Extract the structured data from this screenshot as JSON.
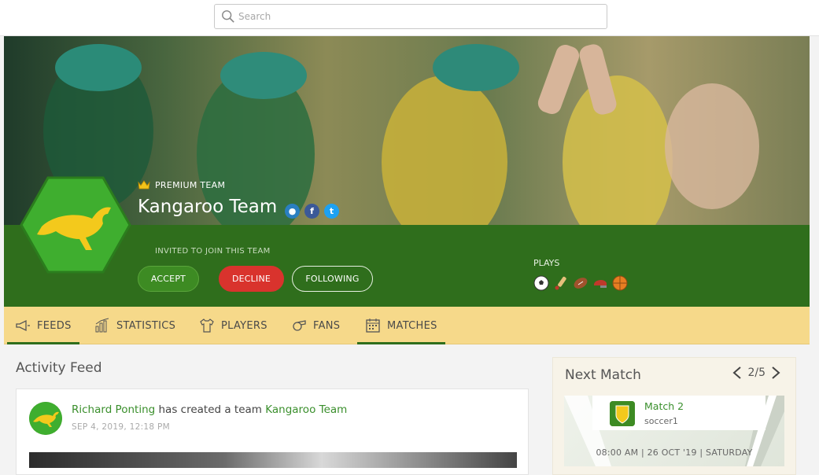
{
  "search": {
    "placeholder": "Search"
  },
  "team": {
    "premium_label": "PREMIUM TEAM",
    "name": "Kangaroo Team",
    "invited_label": "INVITED TO JOIN THIS TEAM",
    "plays_label": "PLAYS",
    "sports": [
      "soccer-ball-icon",
      "cricket-bat-icon",
      "rugby-ball-icon",
      "cricket-helmet-icon",
      "basketball-icon"
    ]
  },
  "actions": {
    "accept": "ACCEPT",
    "decline": "DECLINE",
    "following": "FOLLOWING"
  },
  "tabs": [
    {
      "label": "FEEDS",
      "icon": "megaphone-icon",
      "active": true
    },
    {
      "label": "STATISTICS",
      "icon": "bar-chart-icon"
    },
    {
      "label": "PLAYERS",
      "icon": "jersey-icon"
    },
    {
      "label": "FANS",
      "icon": "whistle-icon"
    },
    {
      "label": "MATCHES",
      "icon": "calendar-icon"
    }
  ],
  "feed": {
    "title": "Activity Feed",
    "items": [
      {
        "actor": "Richard Ponting",
        "action": "has created a team",
        "target": "Kangaroo Team",
        "date": "SEP 4, 2019, 12:18 PM"
      }
    ]
  },
  "next_match": {
    "title": "Next Match",
    "page": "2/5",
    "name": "Match 2",
    "sport": "soccer1",
    "datetime": "08:00 AM | 26 OCT '19 | SATURDAY"
  },
  "colors": {
    "brand_green": "#2f6e1c",
    "tab_bar": "#f6d98a",
    "decline_red": "#d9332d",
    "link_green": "#3a8f2c"
  }
}
